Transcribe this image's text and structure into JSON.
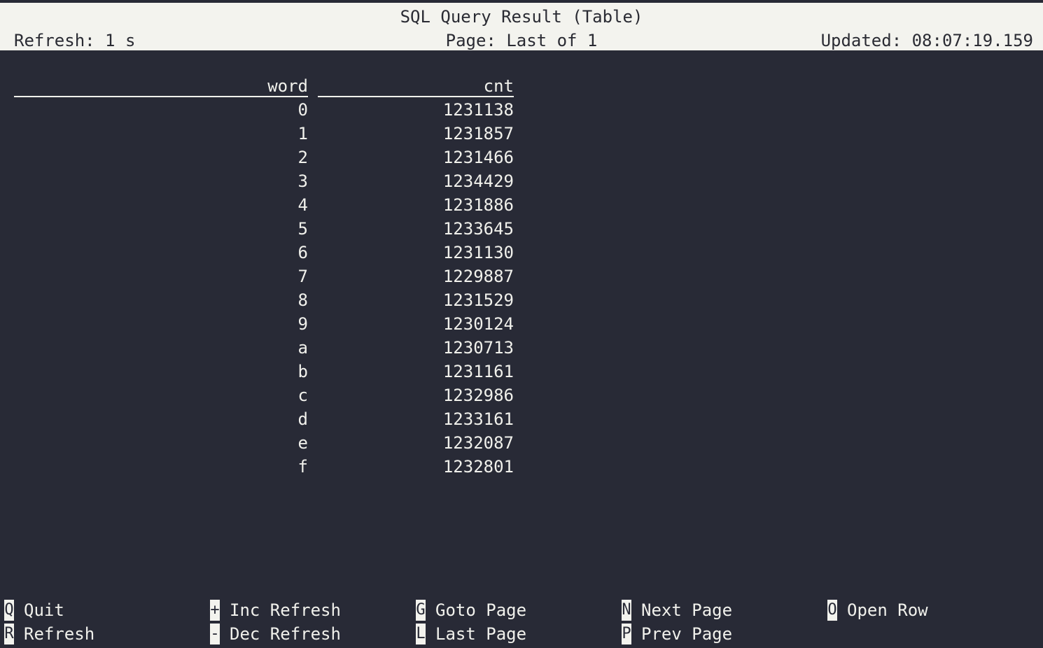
{
  "header": {
    "title": "SQL Query Result (Table)",
    "refresh": "Refresh: 1 s",
    "page": "Page: Last of 1",
    "updated": "Updated: 08:07:19.159"
  },
  "table": {
    "columns": [
      "word",
      "cnt"
    ],
    "rows": [
      [
        "0",
        "1231138"
      ],
      [
        "1",
        "1231857"
      ],
      [
        "2",
        "1231466"
      ],
      [
        "3",
        "1234429"
      ],
      [
        "4",
        "1231886"
      ],
      [
        "5",
        "1233645"
      ],
      [
        "6",
        "1231130"
      ],
      [
        "7",
        "1229887"
      ],
      [
        "8",
        "1231529"
      ],
      [
        "9",
        "1230124"
      ],
      [
        "a",
        "1230713"
      ],
      [
        "b",
        "1231161"
      ],
      [
        "c",
        "1232986"
      ],
      [
        "d",
        "1233161"
      ],
      [
        "e",
        "1232087"
      ],
      [
        "f",
        "1232801"
      ]
    ]
  },
  "footer": {
    "shortcuts": [
      {
        "key": "Q",
        "label": "Quit"
      },
      {
        "key": "R",
        "label": "Refresh"
      },
      {
        "key": "+",
        "label": "Inc Refresh"
      },
      {
        "key": "-",
        "label": "Dec Refresh"
      },
      {
        "key": "G",
        "label": "Goto Page"
      },
      {
        "key": "L",
        "label": "Last Page"
      },
      {
        "key": "N",
        "label": "Next Page"
      },
      {
        "key": "P",
        "label": "Prev Page"
      },
      {
        "key": "O",
        "label": "Open Row"
      }
    ]
  }
}
